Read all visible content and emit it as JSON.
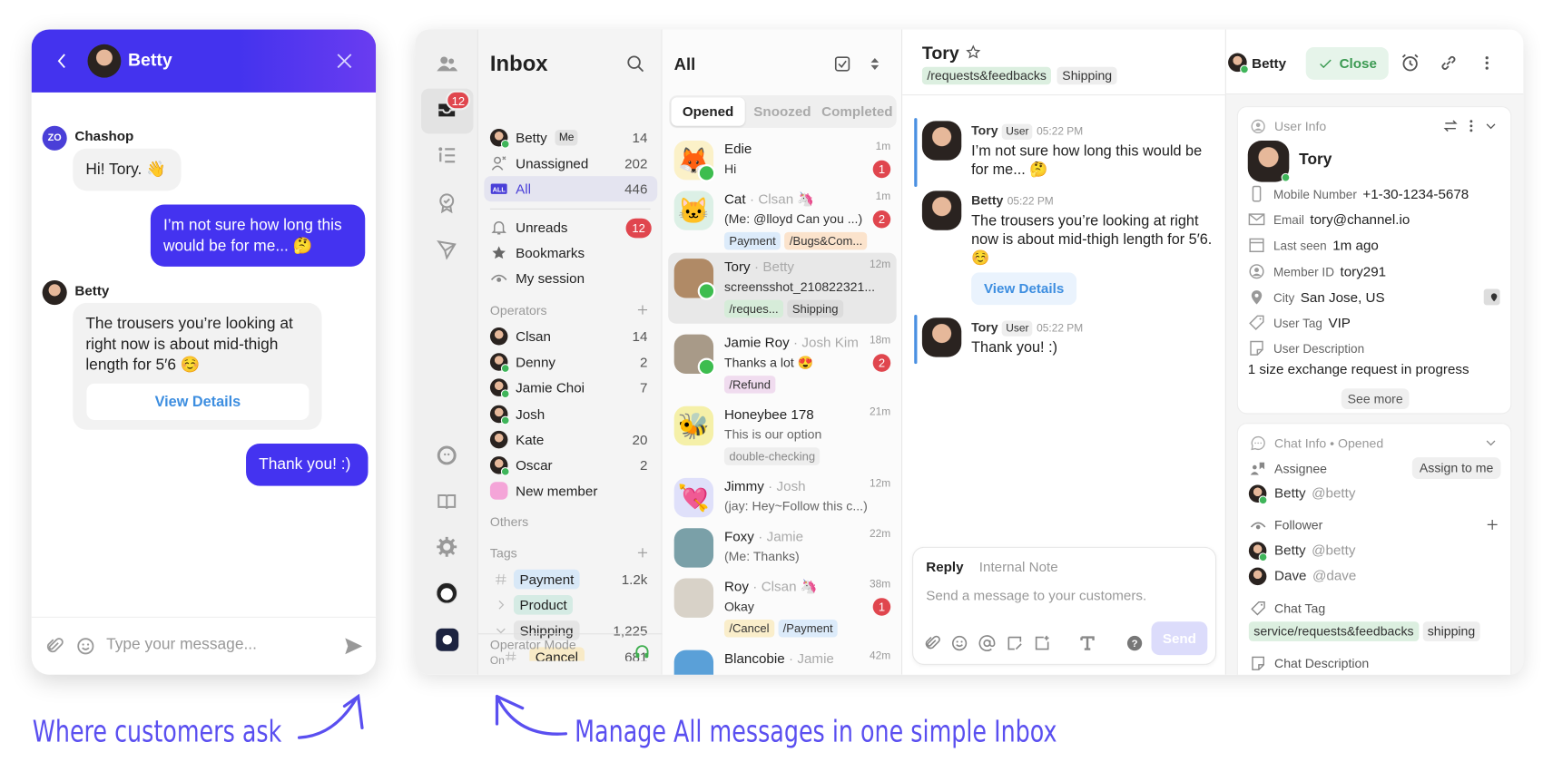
{
  "colors": {
    "primary": "#4433ee",
    "unread_badge": "#e0464e",
    "online": "#3fb55a",
    "caption": "#5a4ff0",
    "close_green": "#3b9a52"
  },
  "widget": {
    "header_name": "Betty",
    "messages": [
      {
        "sender": "Chashop",
        "sender_logo": "ZO",
        "text": "Hi! Tory. 👋"
      },
      {
        "text": "I’m not sure how long this would be for me... 🤔"
      },
      {
        "sender": "Betty",
        "text": "The trousers you’re looking at right now is about mid-thigh length for 5′6 ☺️",
        "button": "View Details"
      },
      {
        "text": "Thank you! :)"
      }
    ],
    "input_placeholder": "Type your message..."
  },
  "captions": {
    "left": "Where customers ask",
    "right": "Manage All messages in one simple Inbox"
  },
  "rail": {
    "inbox_badge": "12",
    "icons": [
      "people-icon",
      "inbox-icon",
      "list-icon",
      "badge-icon",
      "send-icon",
      "bot-icon",
      "book-icon",
      "gear-icon",
      "user-avatar",
      "app-logo"
    ]
  },
  "sidebar": {
    "title": "Inbox",
    "items": [
      {
        "label": "Betty",
        "tag": "Me",
        "count": "14",
        "icon": "avatar"
      },
      {
        "label": "Unassigned",
        "count": "202",
        "icon": "unassigned"
      },
      {
        "label": "All",
        "count": "446",
        "icon": "all",
        "selected": true
      },
      {
        "label": "Unreads",
        "badge": "12",
        "icon": "bell"
      },
      {
        "label": "Bookmarks",
        "icon": "star"
      },
      {
        "label": "My session",
        "icon": "eye"
      }
    ],
    "operators_label": "Operators",
    "operators": [
      {
        "label": "Clsan",
        "count": "14"
      },
      {
        "label": "Denny",
        "count": "2",
        "online": true
      },
      {
        "label": "Jamie Choi",
        "count": "7",
        "online": true
      },
      {
        "label": "Josh",
        "online": true
      },
      {
        "label": "Kate",
        "count": "20"
      },
      {
        "label": "Oscar",
        "count": "2",
        "online": true
      },
      {
        "label": "New member"
      }
    ],
    "others_label": "Others",
    "tags_label": "Tags",
    "tags": [
      {
        "label": "Payment",
        "count": "1.2k",
        "color": "#d8e8f7",
        "icon": "hash"
      },
      {
        "label": "Product",
        "color": "#d5ebe4",
        "icon": "chevron-right"
      },
      {
        "label": "Shipping",
        "count": "1,225",
        "color": "#e5e5e5",
        "icon": "chevron-down"
      },
      {
        "label": "Cancel",
        "count": "681",
        "color": "#f8eac6",
        "icon": "hash",
        "indent": true
      }
    ],
    "operator_mode_label": "Operator Mode",
    "operator_mode_value": "On"
  },
  "list": {
    "title": "All",
    "tabs": [
      {
        "label": "Opened",
        "active": true
      },
      {
        "label": "Snoozed"
      },
      {
        "label": "Completed"
      }
    ],
    "conversations": [
      {
        "name": "Edie",
        "time": "1m",
        "preview": "Hi",
        "unread": "1",
        "avatar": "🦊",
        "avatar_bg": "#fbf1c8",
        "line": true
      },
      {
        "name": "Cat",
        "assignee": "Clsan 🦄",
        "time": "1m",
        "preview": "(Me: @lloyd Can you ...)",
        "unread": "2",
        "avatar": "🐱",
        "avatar_bg": "#dcf0e6",
        "tags": [
          {
            "label": "Payment",
            "color": "#dcebfa"
          },
          {
            "label": "/Bugs&Com...",
            "color": "#fbe3cc"
          }
        ]
      },
      {
        "name": "Tory",
        "assignee": "Betty",
        "time": "12m",
        "preview": "screensshot_210822321...",
        "avatar_bg": "#b08a66",
        "line": true,
        "selected": true,
        "tags": [
          {
            "label": "/reques...",
            "color": "#d6ecd9"
          },
          {
            "label": "Shipping",
            "color": "#dcdcdc"
          }
        ]
      },
      {
        "name": "Jamie Roy",
        "assignee": "Josh Kim",
        "time": "18m",
        "preview": "Thanks a lot 😍",
        "unread": "2",
        "avatar_bg": "#a89a88",
        "line": true,
        "tags": [
          {
            "label": "/Refund",
            "color": "#f0dcef"
          }
        ]
      },
      {
        "name": "Honeybee 178",
        "time": "21m",
        "preview": "This is our option",
        "avatar": "🐝",
        "avatar_bg": "#f5f0a8",
        "muted": true,
        "tags": [
          {
            "label": "double-checking",
            "color": "#eeeeee"
          }
        ]
      },
      {
        "name": "Jimmy",
        "assignee": "Josh",
        "time": "12m",
        "preview": "(jay: Hey~Follow this c...)",
        "avatar": "💘",
        "avatar_bg": "#dfe0fa",
        "muted": true
      },
      {
        "name": "Foxy",
        "assignee": "Jamie",
        "time": "22m",
        "preview": "(Me: Thanks)",
        "avatar_bg": "#7aa0a8",
        "muted": true
      },
      {
        "name": "Roy",
        "assignee": "Clsan 🦄",
        "time": "38m",
        "preview": "Okay",
        "unread": "1",
        "avatar_bg": "#d8d2c8",
        "tags": [
          {
            "label": "/Cancel",
            "color": "#faeecb"
          },
          {
            "label": "/Payment",
            "color": "#dcebfa"
          }
        ]
      },
      {
        "name": "Blancobie",
        "assignee": "Jamie",
        "time": "42m",
        "avatar_bg": "#5aa0d8"
      }
    ]
  },
  "chat": {
    "title": "Tory",
    "tags": [
      {
        "label": "/requests&feedbacks",
        "color": "#dcefe0"
      },
      {
        "label": "Shipping",
        "color": "#eeeeee"
      }
    ],
    "assignee": "Betty",
    "close_label": "Close",
    "messages": [
      {
        "name": "Tory",
        "badge": "User",
        "time": "05:22 PM",
        "text": "I’m not sure how long this would be for me... 🤔",
        "user": true
      },
      {
        "name": "Betty",
        "time": "05:22 PM",
        "text": "The trousers you’re looking at right now is about mid-thigh length for 5′6. ☺️",
        "button": "View Details"
      },
      {
        "name": "Tory",
        "badge": "User",
        "time": "05:22 PM",
        "text": "Thank you! :)",
        "user": true
      }
    ],
    "composer": {
      "tab_reply": "Reply",
      "tab_note": "Internal Note",
      "placeholder": "Send a message to your customers.",
      "send_label": "Send"
    }
  },
  "user_info": {
    "section_title": "User Info",
    "name": "Tory",
    "fields": [
      {
        "key": "Mobile Number",
        "value": "+1-30-1234-5678",
        "icon": "phone"
      },
      {
        "key": "Email",
        "value": "tory@channel.io",
        "icon": "mail"
      },
      {
        "key": "Last seen",
        "value": "1m ago",
        "icon": "calendar"
      },
      {
        "key": "Member ID",
        "value": "tory291",
        "icon": "user-circle"
      },
      {
        "key": "City",
        "value": "San Jose, US",
        "icon": "pin"
      },
      {
        "key": "User Tag",
        "value": "VIP",
        "icon": "tag"
      },
      {
        "key": "User Description",
        "value": "",
        "icon": "note"
      }
    ],
    "description": "1 size exchange request in progress",
    "see_more": "See more"
  },
  "chat_info": {
    "section_title": "Chat Info • Opened",
    "assignee_label": "Assignee",
    "assign_to_me": "Assign to me",
    "assignee": {
      "name": "Betty",
      "handle": "@betty"
    },
    "follower_label": "Follower",
    "followers": [
      {
        "name": "Betty",
        "handle": "@betty",
        "online": true
      },
      {
        "name": "Dave",
        "handle": "@dave"
      }
    ],
    "chat_tag_label": "Chat Tag",
    "chat_tags": [
      {
        "label": "service/requests&feedbacks",
        "color": "#dcefe0"
      },
      {
        "label": "shipping",
        "color": "#eeeeee"
      }
    ],
    "chat_description_label": "Chat Description"
  }
}
